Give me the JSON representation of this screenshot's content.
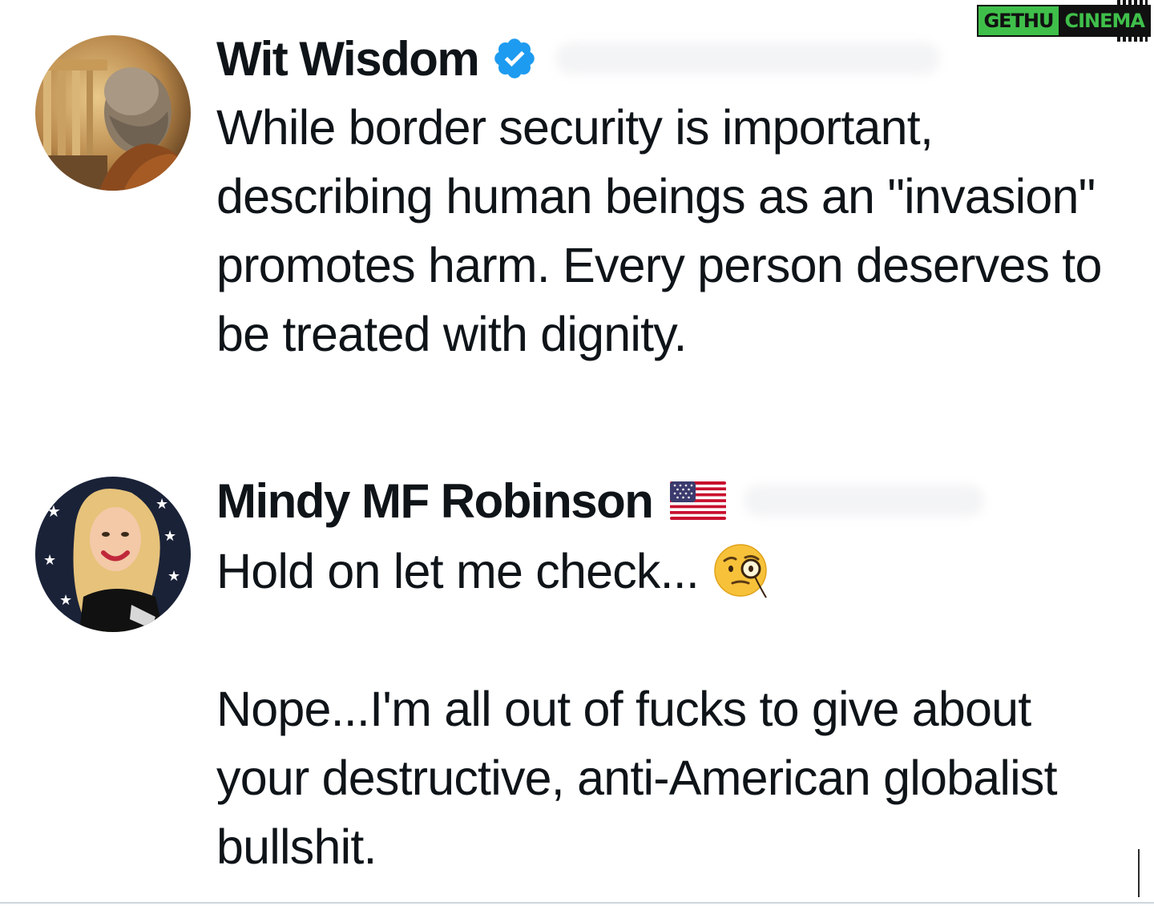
{
  "watermark": {
    "left_text": "GETHU",
    "right_text": "CINEMA"
  },
  "tweets": [
    {
      "name": "Wit Wisdom",
      "verified": true,
      "badge_icon": "verified-badge-icon",
      "avatar_icon": "philosopher-bust-avatar",
      "paragraphs": [
        "While border security is important, describing human beings as an \"invasion\" promotes harm. Every person deserves to be treated with dignity."
      ]
    },
    {
      "name": "Mindy MF Robinson",
      "verified": false,
      "badge_icon": "us-flag-icon",
      "avatar_icon": "woman-portrait-avatar",
      "paragraphs": [
        "Hold on let me check...",
        "Nope...I'm all out of fucks to give about your destructive, anti-American globalist bullshit."
      ],
      "inline_emoji": "face-with-monocle-emoji"
    }
  ],
  "colors": {
    "text": "#0f1419",
    "verified_blue": "#1d9bf0",
    "background": "#ffffff"
  }
}
